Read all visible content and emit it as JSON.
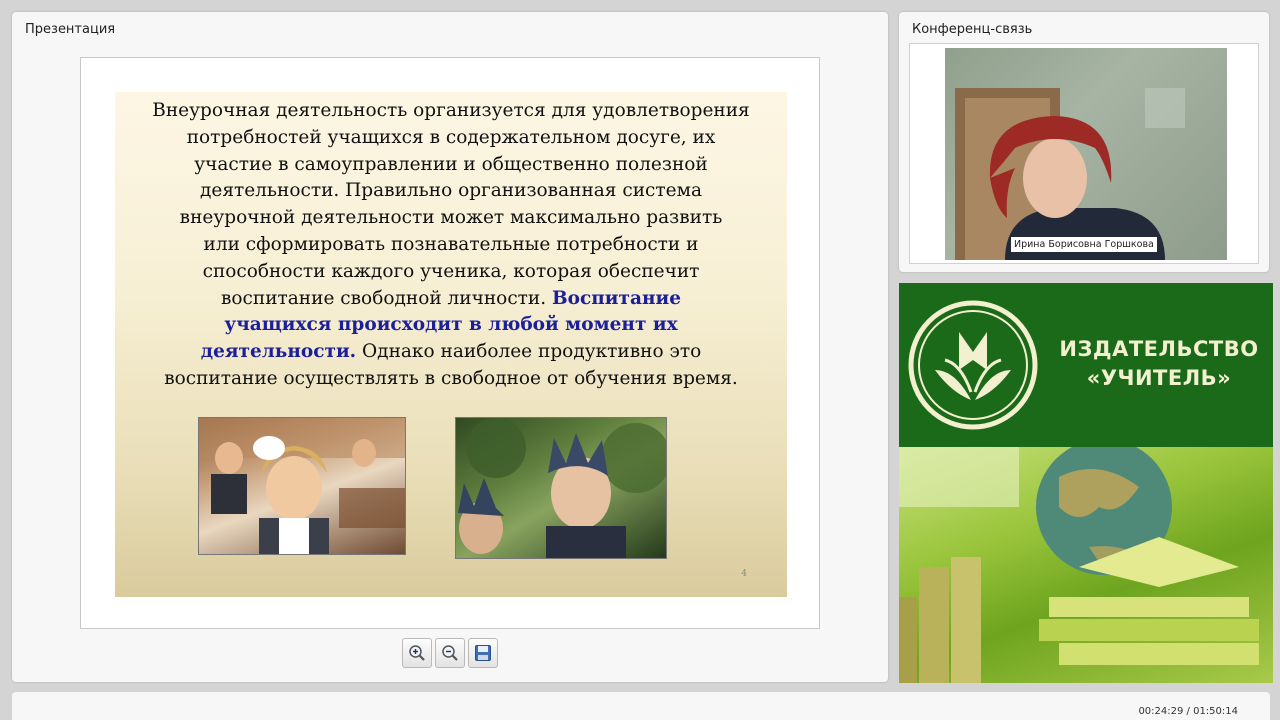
{
  "presentation": {
    "title": "Презентация",
    "slide": {
      "text_lines": [
        "Внеурочная деятельность организуется для удовлетворения",
        "потребностей учащихся в содержательном досуге, их",
        "участие в самоуправлении и общественно полезной",
        "деятельности. Правильно организованная система",
        "внеурочной деятельности может максимально развить",
        "или сформировать познавательные потребности и",
        "способности каждого ученика, которая обеспечит"
      ],
      "line8_normal": "воспитание свободной личности.",
      "line8_highlight": "Воспитание",
      "line9_highlight": "учащихся происходит в любой момент их",
      "line10_highlight": "деятельности.",
      "line10_normal": "Однако наиболее продуктивно это",
      "line11": "воспитание осуществлять в свободное от обучения время.",
      "page_number": "4",
      "highlight_color": "#1c1f9a"
    },
    "toolbar": {
      "zoom_in_icon": "zoom-in-icon",
      "zoom_out_icon": "zoom-out-icon",
      "save_icon": "floppy-disk-icon"
    }
  },
  "conference": {
    "title": "Конференц-связь",
    "participant_name": "Ирина Борисовна Горшкова"
  },
  "banner": {
    "line1": "ИЗДАТЕЛЬСТВО",
    "line2": "«УЧИТЕЛЬ»",
    "color": "#1b6a1a"
  },
  "playback": {
    "time": "00:24:29 / 01:50:14"
  }
}
